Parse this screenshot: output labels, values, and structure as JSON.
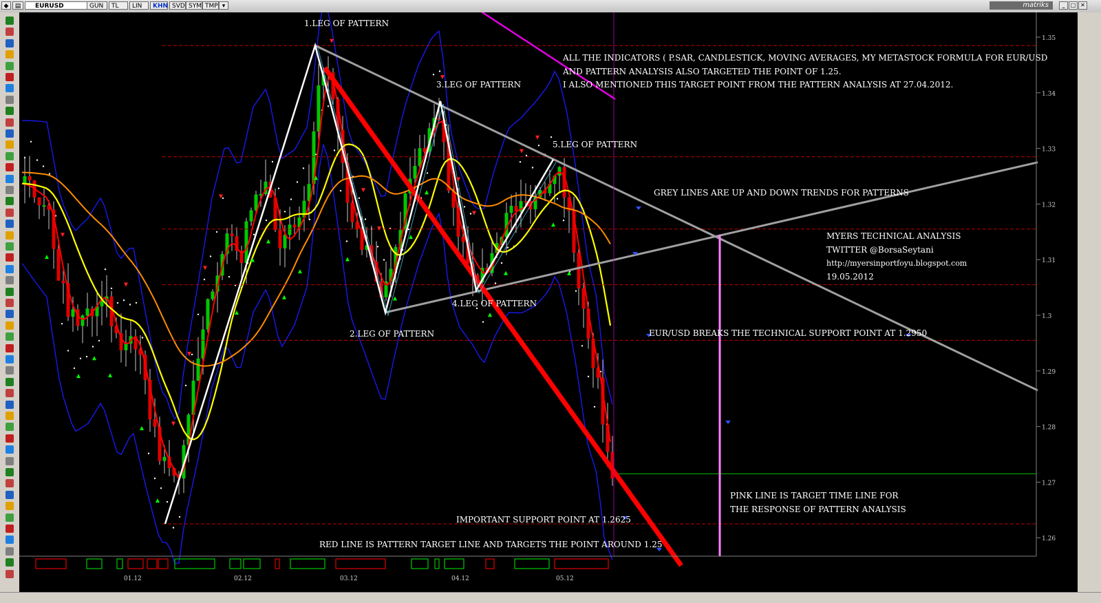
{
  "toolbar": {
    "symbol": "EURUSD",
    "buttons": [
      "GUN",
      "TL",
      "LIN",
      "KHN",
      "SVD",
      "SYM",
      "TMP"
    ],
    "active_button": "KHN",
    "brand": "matriks"
  },
  "annotations": {
    "leg1": "1.LEG OF PATTERN",
    "leg2": "2.LEG OF PATTERN",
    "leg3": "3.LEG OF PATTERN",
    "leg4": "4.LEG OF PATTERN",
    "leg5": "5.LEG OF PATTERN",
    "indicators_1": "ALL THE INDICATORS ( P.SAR, CANDLESTICK, MOVING AVERAGES, MY METASTOCK FORMULA FOR EUR/USD",
    "indicators_2": "AND PATTERN ANALYSIS ALSO TARGETED THE POINT OF 1.25.",
    "indicators_3": "I ALSO MENTIONED THIS TARGET POINT FROM THE PATTERN ANALYSIS AT 27.04.2012.",
    "grey_lines": "GREY LINES ARE UP AND DOWN TRENDS FOR PATTERNS",
    "author_1": "MYERS TECHNICAL ANALYSIS",
    "author_2": "TWITTER @BorsaSeytani",
    "author_3": "http://myersinportfoyu.blogspot.com",
    "author_4": "19.05.2012",
    "breaks": "EUR/USD BREAKS THE TECHNICAL SUPPORT POINT AT 1.2950",
    "pink_1": "PINK LINE IS TARGET TIME LINE FOR",
    "pink_2": "THE RESPONSE OF PATTERN ANALYSIS",
    "support": "IMPORTANT SUPPORT POINT AT 1.2625",
    "red_line": "RED LINE IS PATTERN TARGET LINE AND TARGETS THE POINT AROUND  1.25"
  },
  "colors": {
    "background": "#000000",
    "bullish": "#00c800",
    "bearish": "#e00000",
    "ma_short": "#ff0000",
    "ma_mid": "#ffff00",
    "ma_long": "#ff8c00",
    "bollinger": "#1a1aff",
    "trend_lines": "#a0a0a0",
    "target_line": "#ff0000",
    "time_line": "#ff80ff",
    "pattern": "#ffffff",
    "psar": "#ffffff"
  },
  "chart_data": {
    "type": "candlestick",
    "symbol": "EURUSD",
    "x_labels": [
      "01.12",
      "02.12",
      "03.12",
      "04.12",
      "05.12"
    ],
    "y_ticks": [
      1.26,
      1.27,
      1.28,
      1.29,
      1.3,
      1.31,
      1.32,
      1.33,
      1.34,
      1.35
    ],
    "ylim": [
      1.2575,
      1.3555
    ],
    "horizontal_levels": [
      1.3485,
      1.3285,
      1.3155,
      1.3055,
      1.2955,
      1.2715,
      1.2625
    ],
    "pattern_points": [
      {
        "label": "1",
        "date": "02.2012",
        "price": 1.3485
      },
      {
        "label": "2",
        "date": "03.2012",
        "price": 1.3005
      },
      {
        "label": "3",
        "date": "03.2012",
        "price": 1.3385
      },
      {
        "label": "4",
        "date": "04.2012",
        "price": 1.3045
      },
      {
        "label": "5",
        "date": "04.2012",
        "price": 1.328
      }
    ],
    "support_level": 1.2625,
    "breakdown_level": 1.295,
    "target_level": 1.25,
    "grid": false,
    "legend": "none"
  }
}
